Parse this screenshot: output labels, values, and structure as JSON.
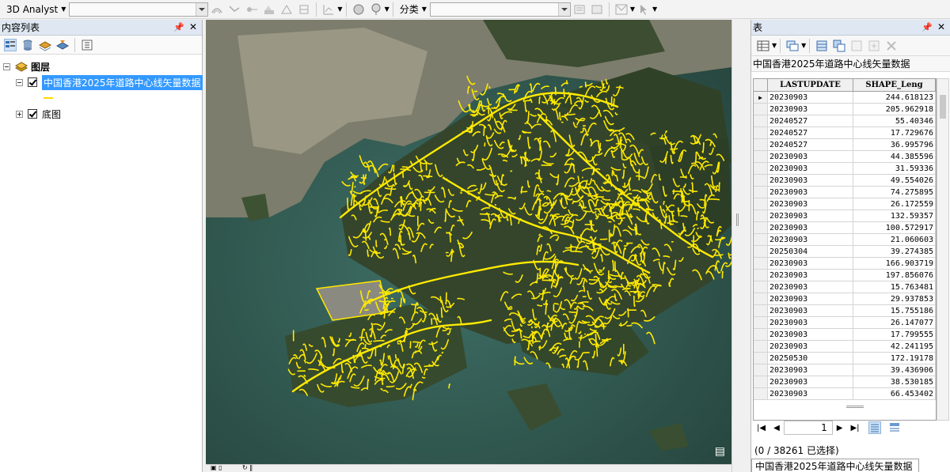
{
  "toolbar": {
    "analyst_label": "3D Analyst",
    "classify_label": "分类"
  },
  "toc": {
    "title": "内容列表",
    "root_label": "图层",
    "layer_label": "中国香港2025年道路中心线矢量数据",
    "basemap_label": "底图",
    "layer_color": "#ffd800"
  },
  "table_panel": {
    "title": "表",
    "table_name": "中国香港2025年道路中心线矢量数据",
    "columns": [
      "LASTUPDATE",
      "SHAPE_Leng"
    ],
    "rows": [
      [
        "20230903",
        "244.618123"
      ],
      [
        "20230903",
        "205.962918"
      ],
      [
        "20240527",
        "55.40346"
      ],
      [
        "20240527",
        "17.729676"
      ],
      [
        "20240527",
        "36.995796"
      ],
      [
        "20230903",
        "44.385596"
      ],
      [
        "20230903",
        "31.59336"
      ],
      [
        "20230903",
        "49.554026"
      ],
      [
        "20230903",
        "74.275895"
      ],
      [
        "20230903",
        "26.172559"
      ],
      [
        "20230903",
        "132.59357"
      ],
      [
        "20230903",
        "100.572917"
      ],
      [
        "20230903",
        "21.060603"
      ],
      [
        "20250304",
        "39.274385"
      ],
      [
        "20230903",
        "166.903719"
      ],
      [
        "20230903",
        "197.856076"
      ],
      [
        "20230903",
        "15.763481"
      ],
      [
        "20230903",
        "29.937853"
      ],
      [
        "20230903",
        "15.755186"
      ],
      [
        "20230903",
        "26.147077"
      ],
      [
        "20230903",
        "17.799555"
      ],
      [
        "20230903",
        "42.241195"
      ],
      [
        "20250530",
        "172.19178"
      ],
      [
        "20230903",
        "39.436906"
      ],
      [
        "20230903",
        "38.530185"
      ],
      [
        "20230903",
        "66.453402"
      ]
    ],
    "current_record": "1",
    "status": "(0 / 38261 已选择)",
    "tab_label": "中国香港2025年道路中心线矢量数据"
  }
}
